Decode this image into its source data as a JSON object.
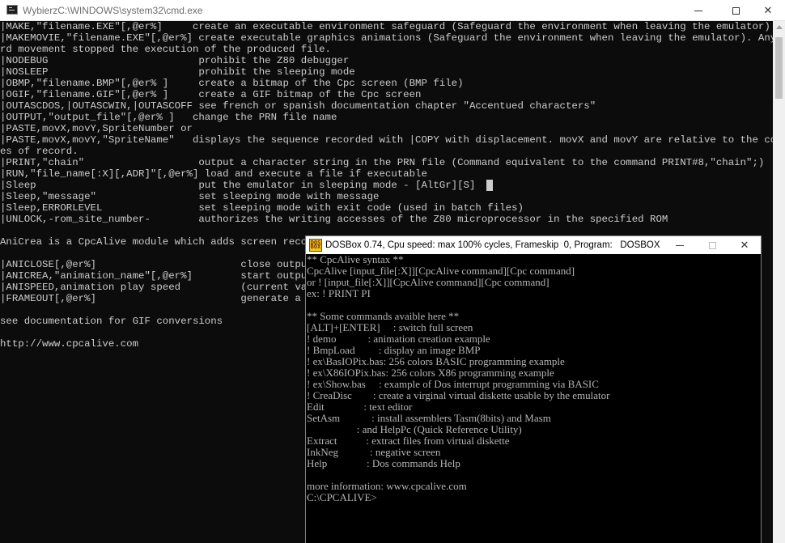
{
  "cmd": {
    "title": "WybierzC:\\WINDOWS\\system32\\cmd.exe",
    "lines": [
      "|MAKE,\"filename.EXE\"[,@er%]     create an executable environment safeguard (Safeguard the environment when leaving the emulator)",
      "|MAKEMOVIE,\"filename.EXE\"[,@er%] create executable graphics animations (Safeguard the environment when leaving the emulator). Any keyboa",
      "rd movement stopped the execution of the produced file.",
      "|NODEBUG                         prohibit the Z80 debugger",
      "|NOSLEEP                         prohibit the sleeping mode",
      "|OBMP,\"filename.BMP\"[,@er% ]     create a bitmap of the Cpc screen (BMP file)",
      "|OGIF,\"filename.GIF\"[,@er% ]     create a GIF bitmap of the Cpc screen",
      "|OUTASCDOS,|OUTASCWIN,|OUTASCOFF see french or spanish documentation chapter \"Accentued characters\"",
      "|OUTPUT,\"output_file\"[,@er% ]   change the PRN file name",
      "|PASTE,movX,movY,SpriteNumber or",
      "|PASTE,movX,movY,\"SpriteName\"   displays the sequence recorded with |COPY with displacement. movX and movY are relative to the coordinat",
      "es of record.",
      "|PRINT,\"chain\"                   output a character string in the PRN file (Command equivalent to the command PRINT#8,\"chain\";)",
      "|RUN,\"file_name[:X][,ADR]\"[,@er%] load and execute a file if executable",
      "|Sleep                           put the emulator in sleeping mode - [AltGr][S]",
      "|Sleep,\"message\"                 set sleeping mode with message",
      "|Sleep,ERRORLEVEL                set sleeping mode with exit code (used in batch files)",
      "|UNLOCK,-rom_site_number-        authorizes the writing accesses of the Z80 microprocessor in the specified ROM",
      "",
      "AniCrea is a CpcAlive module which adds screen recordi",
      "",
      "|ANICLOSE[,@er%]                        close output f",
      "|ANICREA,\"animation_name\"[,@er%]        start output f",
      "|ANISPEED,animation play speed          (current value",
      "|FRAMEOUT[,@er%]                        generate a fra",
      "",
      "see documentation for GIF conversions",
      "",
      "http://www.cpcalive.com"
    ]
  },
  "dosbox": {
    "title": "DOSBox 0.74, Cpu speed: max 100% cycles, Frameskip  0, Program:   DOSBOX",
    "icon_text": "DOS BOX",
    "lines": [
      "** CpcAlive syntax **",
      "CpcAlive [input_file[:X]][CpcAlive command][Cpc command]",
      "or ! [input_file[:X]][CpcAlive command][Cpc command]",
      "ex: ! PRINT PI",
      "",
      "** Some commands avaible here **",
      "[ALT]+[ENTER]     : switch full screen",
      "! demo            : animation creation example",
      "! BmpLoad         : display an image BMP",
      "! ex\\BasIOPix.bas: 256 colors BASIC programming example",
      "! ex\\X86IOPix.bas: 256 colors X86 programming example",
      "! ex\\Show.bas     : example of Dos interrupt programming via BASIC",
      "! CreaDisc        : create a virginal virtual diskette usable by the emulator",
      "Edit               : text editor",
      "SetAsm            : install assemblers Tasm(8bits) and Masm",
      "                   : and HelpPc (Quick Reference Utility)",
      "Extract           : extract files from virtual diskette",
      "InkNeg            : negative screen",
      "Help               : Dos commands Help",
      "",
      "more information: www.cpcalive.com",
      "C:\\CPCALIVE>"
    ]
  }
}
